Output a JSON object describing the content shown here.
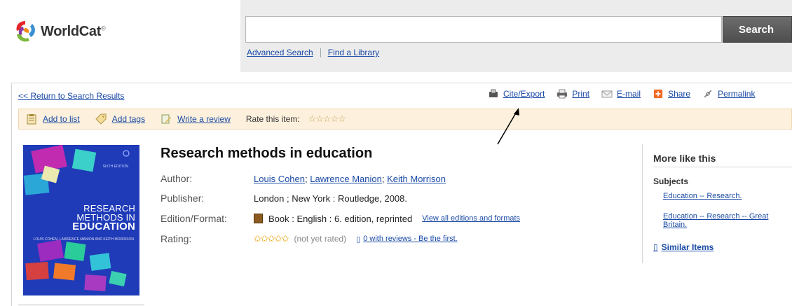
{
  "header": {
    "logo_text": "WorldCat",
    "logo_mark": "®",
    "search_value": "",
    "search_button": "Search",
    "links": [
      "Advanced Search",
      "Find a Library"
    ]
  },
  "nav": {
    "return_link": "<< Return to Search Results",
    "tools": [
      {
        "label": "Cite/Export",
        "icon": "cite-export-icon"
      },
      {
        "label": "Print",
        "icon": "printer-icon"
      },
      {
        "label": "E-mail",
        "icon": "envelope-icon"
      },
      {
        "label": "Share",
        "icon": "plus-share-icon"
      },
      {
        "label": "Permalink",
        "icon": "chain-link-icon"
      }
    ]
  },
  "toolbar": {
    "add_to_list": "Add to list",
    "add_tags": "Add tags",
    "write_review": "Write a review",
    "rate_label": "Rate this item:",
    "rate_stars": "☆☆☆☆☆"
  },
  "cover": {
    "edition": "SIXTH EDITION",
    "title_line1": "RESEARCH",
    "title_line2": "METHODS IN",
    "title_line3": "EDUCATION",
    "authors": "LOUIS COHEN, LAWRENCE MANION AND KEITH MORRISON"
  },
  "record": {
    "title": "Research methods in education",
    "author_label": "Author:",
    "authors": [
      "Louis Cohen",
      "Lawrence Manion",
      "Keith Morrison"
    ],
    "author_sep": ";",
    "publisher_label": "Publisher:",
    "publisher": "London ; New York : Routledge, 2008.",
    "edition_label": "Edition/Format:",
    "edition": "Book : English : 6. edition, reprinted",
    "editions_link": "View all editions and formats",
    "rating_label": "Rating:",
    "rating_stars": "✩✩✩✩✩",
    "rating_status": "(not yet rated)",
    "reviews_link": "0 with reviews - Be the first."
  },
  "sidebar": {
    "title": "More like this",
    "subjects_label": "Subjects",
    "subjects": [
      "Education -- Research.",
      "Education -- Research -- Great Britain."
    ],
    "similar_items": "Similar Items"
  }
}
